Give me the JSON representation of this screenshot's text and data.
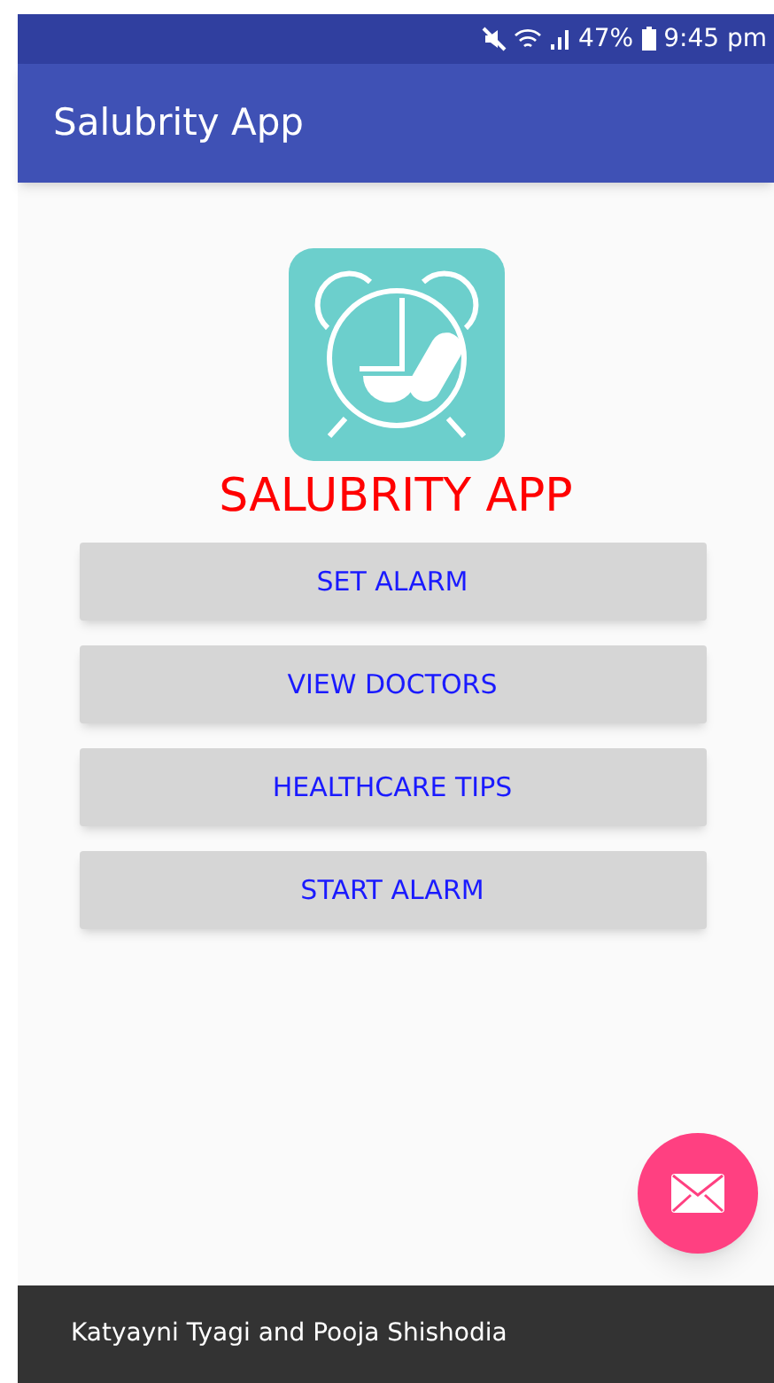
{
  "status_bar": {
    "battery": "47%",
    "time": "9:45 pm"
  },
  "app_bar": {
    "title": "Salubrity App"
  },
  "heading": "SALUBRITY APP",
  "buttons": [
    "SET ALARM",
    "VIEW DOCTORS",
    "HEALTHCARE TIPS",
    "START ALARM"
  ],
  "footer": "Katyayni Tyagi and Pooja Shishodia"
}
